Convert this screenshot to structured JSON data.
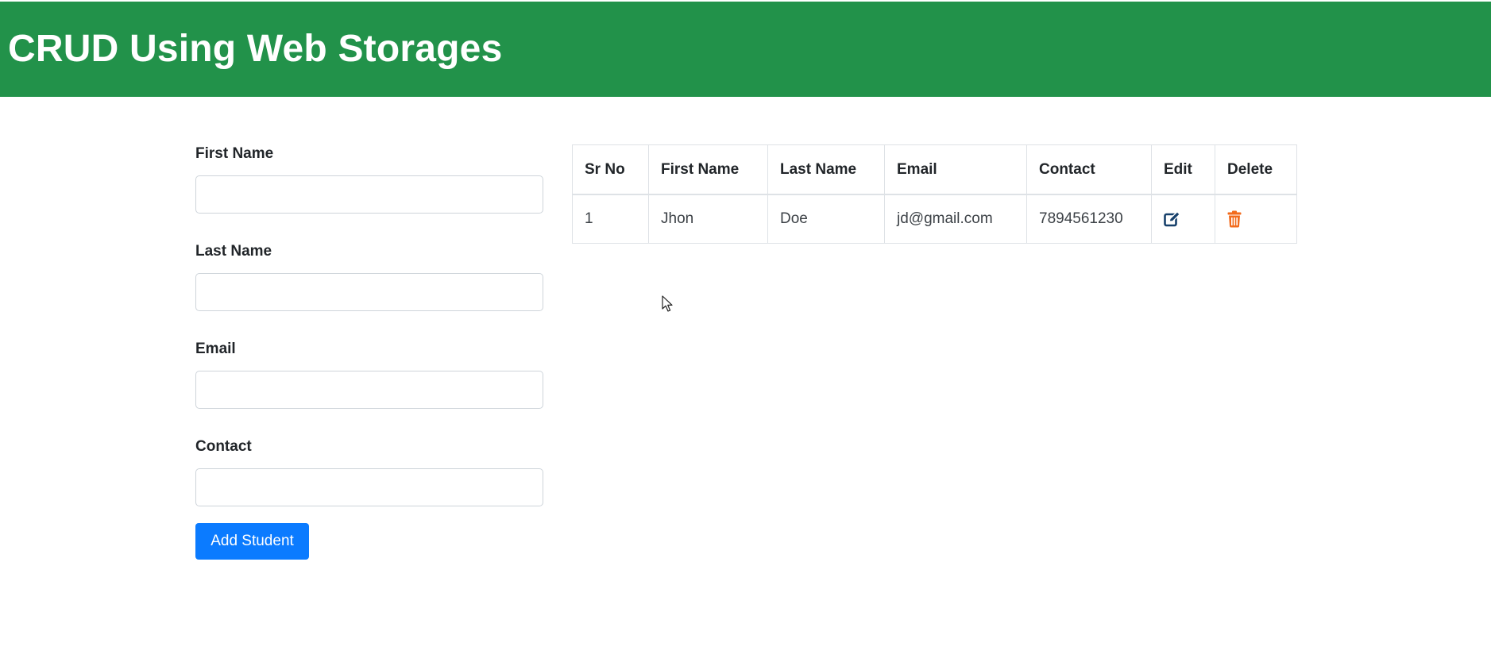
{
  "header": {
    "title": "CRUD Using Web Storages",
    "background": "#22924a"
  },
  "form": {
    "first_name_label": "First Name",
    "first_name_value": "",
    "last_name_label": "Last Name",
    "last_name_value": "",
    "email_label": "Email",
    "email_value": "",
    "contact_label": "Contact",
    "contact_value": "",
    "submit_label": "Add Student",
    "submit_color": "#0b7bff"
  },
  "table": {
    "headers": [
      "Sr No",
      "First Name",
      "Last Name",
      "Email",
      "Contact",
      "Edit",
      "Delete"
    ],
    "rows": [
      {
        "sr_no": "1",
        "first_name": "Jhon",
        "last_name": "Doe",
        "email": "jd@gmail.com",
        "contact": "7894561230",
        "edit_icon": "edit-icon",
        "delete_icon": "trash-icon"
      }
    ],
    "edit_icon_color": "#17406b",
    "delete_icon_color": "#f26b1d"
  }
}
